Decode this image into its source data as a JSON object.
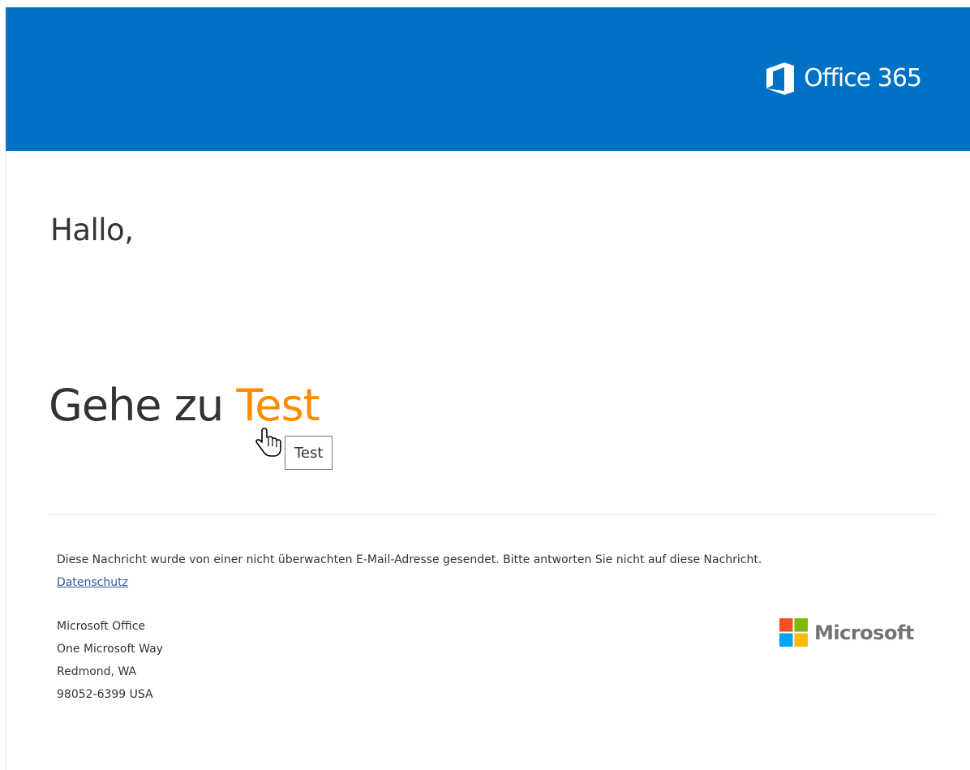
{
  "colors": {
    "header_background": "#0072c6",
    "link_accent": "#ff8c00",
    "text_primary": "#333333",
    "privacy_link": "#2c5aa0",
    "microsoft_wordmark": "#737373",
    "ms_logo_red": "#f25022",
    "ms_logo_green": "#7fba00",
    "ms_logo_blue": "#00a4ef",
    "ms_logo_yellow": "#ffb900"
  },
  "header": {
    "brand_icon": "office-logo-icon",
    "brand_name": "Office 365"
  },
  "body": {
    "greeting": "Hallo,",
    "goto_prefix": "Gehe zu",
    "goto_link": "Test",
    "tooltip": "Test",
    "cursor_icon": "hand-pointer-icon"
  },
  "footer": {
    "notice": "Diese Nachricht wurde von einer nicht überwachten E-Mail-Adresse gesendet. Bitte antworten Sie nicht auf diese Nachricht.",
    "privacy_link": "Datenschutz",
    "address": {
      "line1": "Microsoft Office",
      "line2": "One Microsoft Way",
      "line3": "Redmond, WA",
      "line4": "98052-6399 USA"
    },
    "logo_icon": "microsoft-logo-icon",
    "logo_name": "Microsoft"
  }
}
